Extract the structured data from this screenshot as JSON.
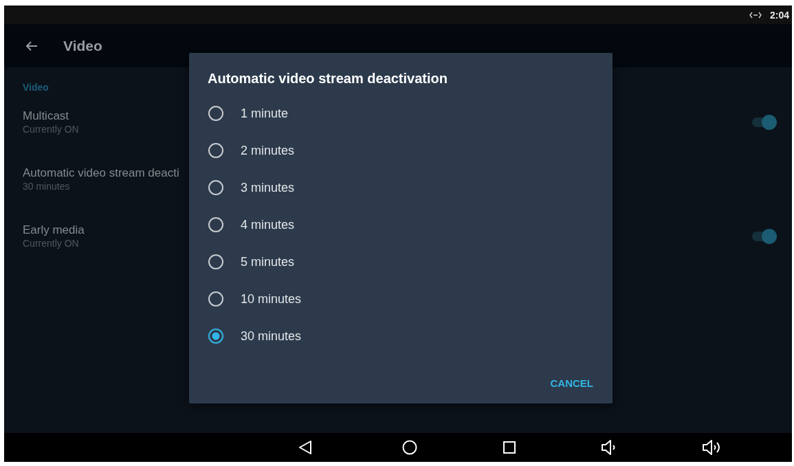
{
  "status_bar": {
    "time": "2:04"
  },
  "toolbar": {
    "title": "Video"
  },
  "section": {
    "header": "Video"
  },
  "settings": [
    {
      "kind": "switch",
      "title": "Multicast",
      "summary": "Currently ON",
      "on": true
    },
    {
      "kind": "text",
      "title": "Automatic video stream deacti",
      "summary": "30 minutes"
    },
    {
      "kind": "switch",
      "title": "Early media",
      "summary": "Currently ON",
      "on": true
    }
  ],
  "dialog": {
    "title": "Automatic video stream deactivation",
    "options": [
      {
        "label": "1 minute",
        "selected": false
      },
      {
        "label": "2 minutes",
        "selected": false
      },
      {
        "label": "3 minutes",
        "selected": false
      },
      {
        "label": "4 minutes",
        "selected": false
      },
      {
        "label": "5 minutes",
        "selected": false
      },
      {
        "label": "10 minutes",
        "selected": false
      },
      {
        "label": "30 minutes",
        "selected": true
      }
    ],
    "buttons": [
      "CANCEL"
    ]
  }
}
